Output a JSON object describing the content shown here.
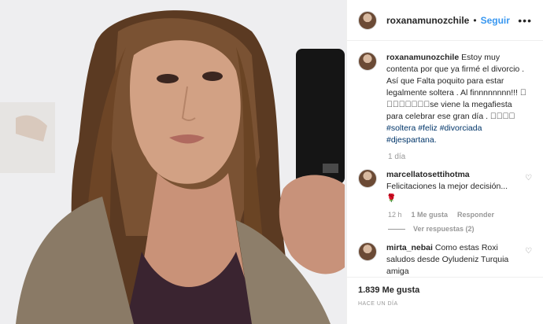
{
  "post": {
    "username": "roxanamunozchile",
    "separator": "•",
    "follow_label": "Seguir",
    "more_icon": "more-options-icon"
  },
  "caption": {
    "username": "roxanamunozchile",
    "text": "Estoy muy contenta por que ya firmé el divorcio . Así que Falta poquito para estar legalmente soltera . Al finnnnnnnn!!! \u0000 \u0000\u0000\u0000\u0000\u0000\u0000\u0000se viene la megafiesta para celebrar ese gran día . \u0000\u0000\u0000\u0000",
    "hashtags": [
      "#soltera",
      "#feliz",
      "#divorciada",
      "#djespartana."
    ],
    "time": "1 día"
  },
  "comments": [
    {
      "username": "marcellatosettihotma",
      "text": "Felicitaciones la mejor decisión...",
      "emoji": "🌹",
      "time": "12 h",
      "likes": "1 Me gusta",
      "reply_label": "Responder",
      "view_replies": "Ver respuestas (2)"
    },
    {
      "username": "mirta_nebai",
      "text": "Como estas Roxi saludos desde Oyludeniz Turquia amiga"
    }
  ],
  "footer": {
    "likes": "1.839 Me gusta",
    "time_ago": "HACE UN DÍA"
  }
}
